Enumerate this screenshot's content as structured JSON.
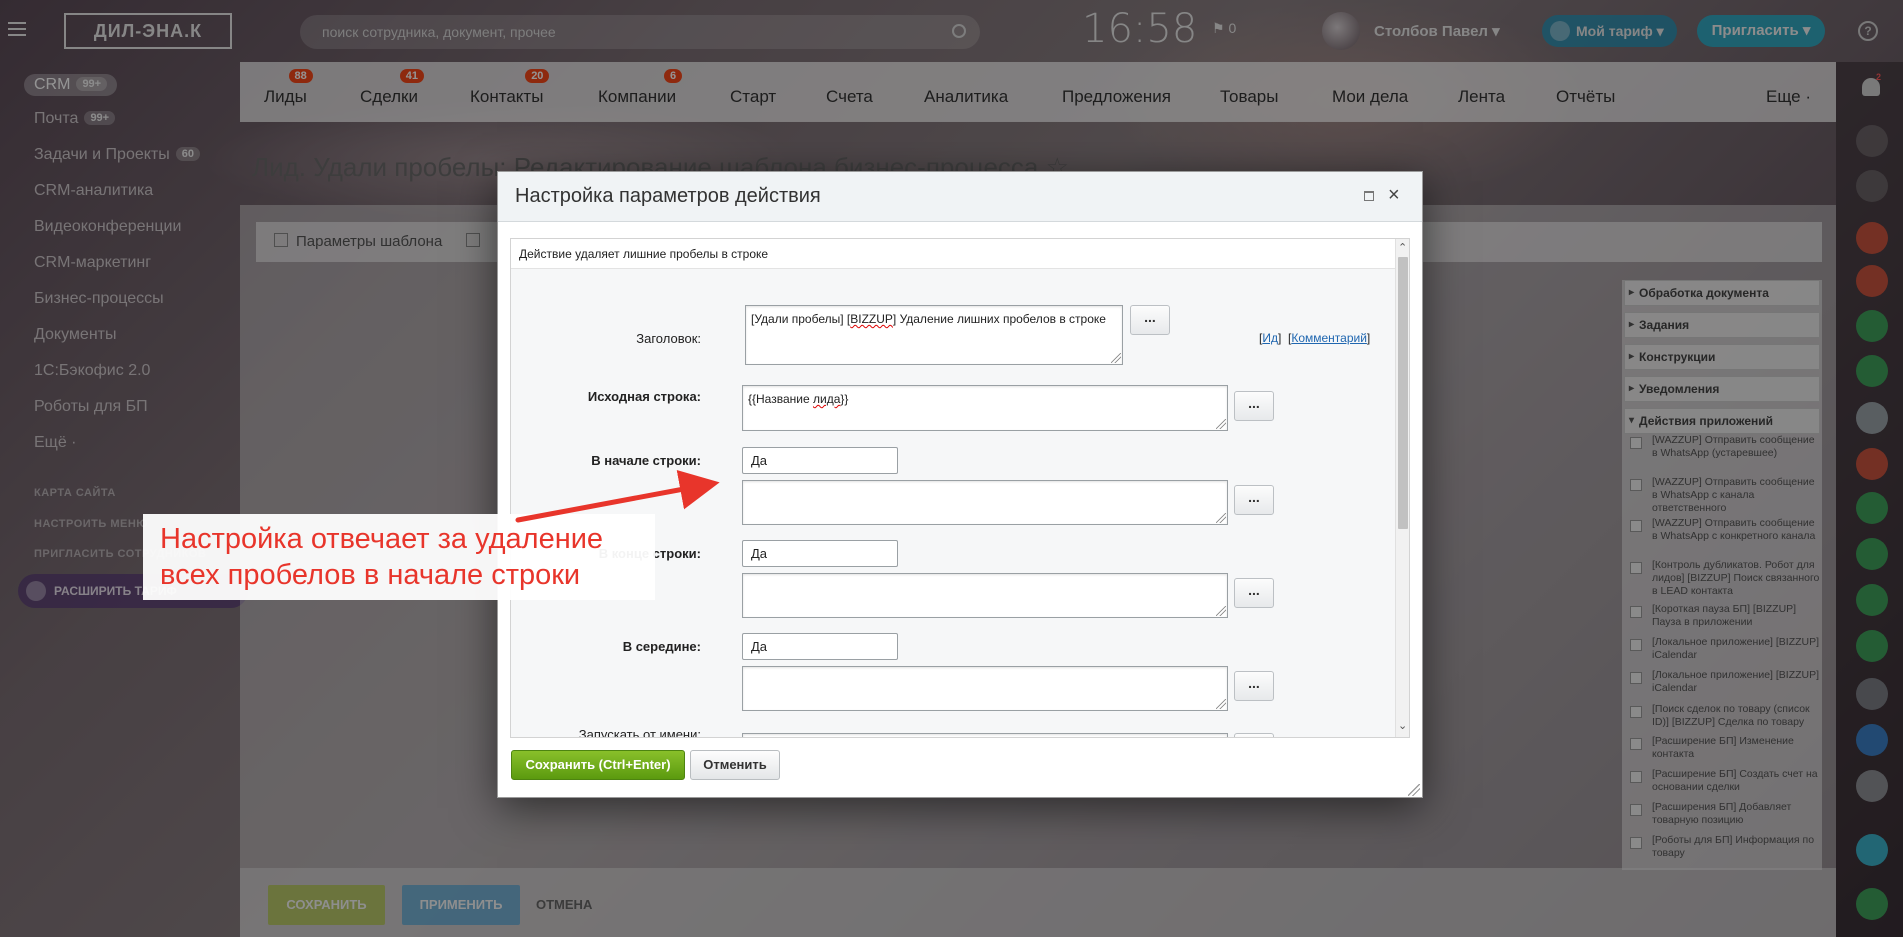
{
  "app": {
    "logo_text": "ДИЛ-ЭНА.К",
    "search_placeholder": "поиск сотрудника, документ, прочее",
    "time": "16:58",
    "flag_count": "0",
    "user_name": "Столбов Павел",
    "tariff_label": "Мой тариф",
    "invite_label": "Пригласить",
    "help_icon": "?"
  },
  "left_nav": {
    "items": [
      {
        "label": "CRM",
        "count": "99+"
      },
      {
        "label": "Почта",
        "count": "99+"
      },
      {
        "label": "Задачи и Проекты",
        "count": "60"
      },
      {
        "label": "CRM-аналитика"
      },
      {
        "label": "Видеоконференции"
      },
      {
        "label": "CRM-маркетинг"
      },
      {
        "label": "Бизнес-процессы"
      },
      {
        "label": "Документы"
      },
      {
        "label": "1С:Бэкофис 2.0"
      },
      {
        "label": "Роботы для БП"
      },
      {
        "label": "Ещё ·"
      }
    ],
    "small_links": [
      "КАРТА САЙТА",
      "НАСТРОИТЬ МЕНЮ",
      "ПРИГЛАСИТЬ СОТРУДНИКОВ"
    ],
    "expand_label": "РАСШИРИТЬ ТАРИФ"
  },
  "crm_tabs": [
    {
      "label": "Лиды",
      "badge": "88"
    },
    {
      "label": "Сделки",
      "badge": "41"
    },
    {
      "label": "Контакты",
      "badge": "20"
    },
    {
      "label": "Компании",
      "badge": "6"
    },
    {
      "label": "Старт"
    },
    {
      "label": "Счета"
    },
    {
      "label": "Аналитика"
    },
    {
      "label": "Предложения"
    },
    {
      "label": "Товары"
    },
    {
      "label": "Мои дела"
    },
    {
      "label": "Лента"
    },
    {
      "label": "Отчёты"
    },
    {
      "label": "Еще ·"
    }
  ],
  "page_title": "Лид. Удали пробелы: Редактирование шаблона бизнес-процесса ☆",
  "template_tabs": [
    "Параметры шаблона"
  ],
  "right_panel": {
    "sections": [
      {
        "label": "Обработка документа"
      },
      {
        "label": "Задания"
      },
      {
        "label": "Конструкции"
      },
      {
        "label": "Уведомления"
      },
      {
        "label": "Действия приложений"
      }
    ],
    "items": [
      "[WAZZUP] Отправить сообщение в WhatsApp (устаревшее)",
      "[WAZZUP] Отправить сообщение в WhatsApp с канала ответственного",
      "[WAZZUP] Отправить сообщение в WhatsApp с конкретного канала",
      "[Контроль дубликатов. Робот для лидов] [BIZZUP] Поиск связанного в LEAD контакта",
      "[Короткая пауза БП] [BIZZUP] Пауза в приложении",
      "[Локальное приложение] [BIZZUP] iCalendar",
      "[Локальное приложение] [BIZZUP] iCalendar",
      "[Поиск сделок по товару (список ID)] [BIZZUP] Сделка по товару",
      "[Расширение БП] Изменение контакта",
      "[Расширение БП] Создать счет на основании сделки",
      "[Расширения БП] Добавляет товарную позицию",
      "[Роботы для БП] Информация по товару"
    ]
  },
  "bottom_bar": {
    "save": "СОХРАНИТЬ",
    "apply": "ПРИМЕНИТЬ",
    "cancel": "ОТМЕНА"
  },
  "dialog": {
    "title": "Настройка параметров действия",
    "description": "Действие удаляет лишние пробелы в строке",
    "fields": {
      "title_label": "Заголовок:",
      "title_value_prefix": "[Удали пробелы] [",
      "title_value_spell": "BIZZUP",
      "title_value_suffix": "] Удаление лишних пробелов в строке",
      "id_link": "Ид",
      "comment_link": "Комментарий",
      "source_label": "Исходная строка:",
      "source_value_prefix": "{{Название ",
      "source_value_spell": "лида",
      "source_value_suffix": "}}",
      "start_label": "В начале строки:",
      "start_value": "Да",
      "end_label": "В конце строки:",
      "end_value": "Да",
      "middle_label": "В середине:",
      "middle_value": "Да",
      "run_as_label": "Запускать от имени:",
      "dots": "..."
    },
    "save_button": "Сохранить (Ctrl+Enter)",
    "cancel_button": "Отменить"
  },
  "annotation": {
    "line1": "Настройка отвечает за удаление",
    "line2": "всех пробелов в начале строки"
  },
  "colors": {
    "annotation_red": "#e8352b",
    "save_green": "#6aa81a",
    "link_blue": "#2067b0",
    "badge_red": "#f54819"
  }
}
